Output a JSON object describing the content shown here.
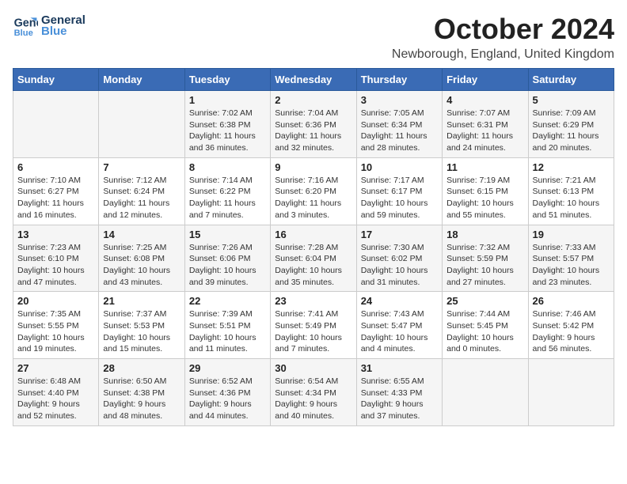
{
  "header": {
    "logo_line1": "General",
    "logo_line2": "Blue",
    "month_title": "October 2024",
    "location": "Newborough, England, United Kingdom"
  },
  "days_of_week": [
    "Sunday",
    "Monday",
    "Tuesday",
    "Wednesday",
    "Thursday",
    "Friday",
    "Saturday"
  ],
  "weeks": [
    [
      {
        "day": "",
        "info": ""
      },
      {
        "day": "",
        "info": ""
      },
      {
        "day": "1",
        "info": "Sunrise: 7:02 AM\nSunset: 6:38 PM\nDaylight: 11 hours and 36 minutes."
      },
      {
        "day": "2",
        "info": "Sunrise: 7:04 AM\nSunset: 6:36 PM\nDaylight: 11 hours and 32 minutes."
      },
      {
        "day": "3",
        "info": "Sunrise: 7:05 AM\nSunset: 6:34 PM\nDaylight: 11 hours and 28 minutes."
      },
      {
        "day": "4",
        "info": "Sunrise: 7:07 AM\nSunset: 6:31 PM\nDaylight: 11 hours and 24 minutes."
      },
      {
        "day": "5",
        "info": "Sunrise: 7:09 AM\nSunset: 6:29 PM\nDaylight: 11 hours and 20 minutes."
      }
    ],
    [
      {
        "day": "6",
        "info": "Sunrise: 7:10 AM\nSunset: 6:27 PM\nDaylight: 11 hours and 16 minutes."
      },
      {
        "day": "7",
        "info": "Sunrise: 7:12 AM\nSunset: 6:24 PM\nDaylight: 11 hours and 12 minutes."
      },
      {
        "day": "8",
        "info": "Sunrise: 7:14 AM\nSunset: 6:22 PM\nDaylight: 11 hours and 7 minutes."
      },
      {
        "day": "9",
        "info": "Sunrise: 7:16 AM\nSunset: 6:20 PM\nDaylight: 11 hours and 3 minutes."
      },
      {
        "day": "10",
        "info": "Sunrise: 7:17 AM\nSunset: 6:17 PM\nDaylight: 10 hours and 59 minutes."
      },
      {
        "day": "11",
        "info": "Sunrise: 7:19 AM\nSunset: 6:15 PM\nDaylight: 10 hours and 55 minutes."
      },
      {
        "day": "12",
        "info": "Sunrise: 7:21 AM\nSunset: 6:13 PM\nDaylight: 10 hours and 51 minutes."
      }
    ],
    [
      {
        "day": "13",
        "info": "Sunrise: 7:23 AM\nSunset: 6:10 PM\nDaylight: 10 hours and 47 minutes."
      },
      {
        "day": "14",
        "info": "Sunrise: 7:25 AM\nSunset: 6:08 PM\nDaylight: 10 hours and 43 minutes."
      },
      {
        "day": "15",
        "info": "Sunrise: 7:26 AM\nSunset: 6:06 PM\nDaylight: 10 hours and 39 minutes."
      },
      {
        "day": "16",
        "info": "Sunrise: 7:28 AM\nSunset: 6:04 PM\nDaylight: 10 hours and 35 minutes."
      },
      {
        "day": "17",
        "info": "Sunrise: 7:30 AM\nSunset: 6:02 PM\nDaylight: 10 hours and 31 minutes."
      },
      {
        "day": "18",
        "info": "Sunrise: 7:32 AM\nSunset: 5:59 PM\nDaylight: 10 hours and 27 minutes."
      },
      {
        "day": "19",
        "info": "Sunrise: 7:33 AM\nSunset: 5:57 PM\nDaylight: 10 hours and 23 minutes."
      }
    ],
    [
      {
        "day": "20",
        "info": "Sunrise: 7:35 AM\nSunset: 5:55 PM\nDaylight: 10 hours and 19 minutes."
      },
      {
        "day": "21",
        "info": "Sunrise: 7:37 AM\nSunset: 5:53 PM\nDaylight: 10 hours and 15 minutes."
      },
      {
        "day": "22",
        "info": "Sunrise: 7:39 AM\nSunset: 5:51 PM\nDaylight: 10 hours and 11 minutes."
      },
      {
        "day": "23",
        "info": "Sunrise: 7:41 AM\nSunset: 5:49 PM\nDaylight: 10 hours and 7 minutes."
      },
      {
        "day": "24",
        "info": "Sunrise: 7:43 AM\nSunset: 5:47 PM\nDaylight: 10 hours and 4 minutes."
      },
      {
        "day": "25",
        "info": "Sunrise: 7:44 AM\nSunset: 5:45 PM\nDaylight: 10 hours and 0 minutes."
      },
      {
        "day": "26",
        "info": "Sunrise: 7:46 AM\nSunset: 5:42 PM\nDaylight: 9 hours and 56 minutes."
      }
    ],
    [
      {
        "day": "27",
        "info": "Sunrise: 6:48 AM\nSunset: 4:40 PM\nDaylight: 9 hours and 52 minutes."
      },
      {
        "day": "28",
        "info": "Sunrise: 6:50 AM\nSunset: 4:38 PM\nDaylight: 9 hours and 48 minutes."
      },
      {
        "day": "29",
        "info": "Sunrise: 6:52 AM\nSunset: 4:36 PM\nDaylight: 9 hours and 44 minutes."
      },
      {
        "day": "30",
        "info": "Sunrise: 6:54 AM\nSunset: 4:34 PM\nDaylight: 9 hours and 40 minutes."
      },
      {
        "day": "31",
        "info": "Sunrise: 6:55 AM\nSunset: 4:33 PM\nDaylight: 9 hours and 37 minutes."
      },
      {
        "day": "",
        "info": ""
      },
      {
        "day": "",
        "info": ""
      }
    ]
  ]
}
